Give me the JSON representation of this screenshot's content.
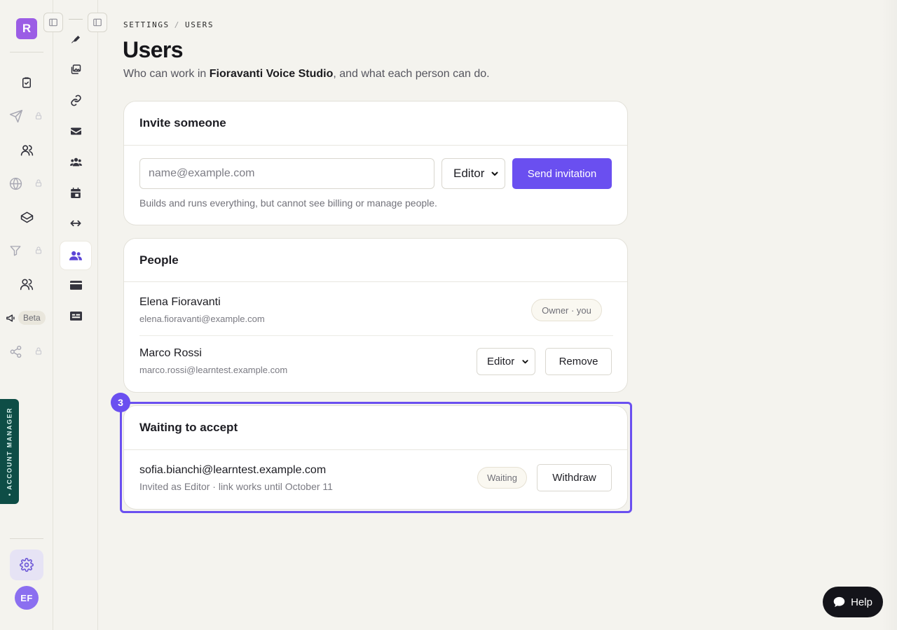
{
  "brand": {
    "letter": "R"
  },
  "primary_nav": [
    {
      "key": "tasks",
      "icon": "clipboard-check-icon",
      "locked": false
    },
    {
      "key": "send",
      "icon": "send-icon",
      "locked": true
    },
    {
      "key": "audience",
      "icon": "users-icon",
      "locked": false
    },
    {
      "key": "web",
      "icon": "globe-icon",
      "locked": true
    },
    {
      "key": "courses",
      "icon": "graduation-cap-icon",
      "locked": false
    },
    {
      "key": "funnels",
      "icon": "funnel-icon",
      "locked": true
    },
    {
      "key": "community",
      "icon": "people-icon",
      "locked": false
    },
    {
      "key": "campaigns",
      "icon": "megaphone-icon",
      "locked": false,
      "badge": "Beta"
    },
    {
      "key": "sharing",
      "icon": "share-icon",
      "locked": true
    }
  ],
  "account_manager_tab": {
    "label": "• ACCOUNT MANAGER"
  },
  "user": {
    "initials": "EF"
  },
  "settings_nav": [
    {
      "icon": "pen-nib-icon",
      "active": false
    },
    {
      "icon": "images-icon",
      "active": false
    },
    {
      "icon": "link-icon",
      "active": false
    },
    {
      "icon": "envelope-icon",
      "active": false
    },
    {
      "icon": "team-icon",
      "active": false
    },
    {
      "icon": "calendar-icon",
      "active": false
    },
    {
      "icon": "arrows-horizontal-icon",
      "active": false
    },
    {
      "icon": "users-active-icon",
      "active": true
    },
    {
      "icon": "credit-card-icon",
      "active": false
    },
    {
      "icon": "id-card-icon",
      "active": false
    }
  ],
  "breadcrumb": {
    "section": "SETTINGS",
    "separator": "/",
    "page": "USERS"
  },
  "page": {
    "title": "Users",
    "subtitle_prefix": "Who can work in ",
    "workspace": "Fioravanti Voice Studio",
    "subtitle_suffix": ", and what each person can do."
  },
  "invite": {
    "heading": "Invite someone",
    "email_placeholder": "name@example.com",
    "role_value": "Editor",
    "send_label": "Send invitation",
    "role_hint": "Builds and runs everything, but cannot see billing or manage people."
  },
  "people": {
    "heading": "People",
    "rows": [
      {
        "name": "Elena Fioravanti",
        "email": "elena.fioravanti@example.com",
        "badge": "Owner · you"
      },
      {
        "name": "Marco Rossi",
        "email": "marco.rossi@learntest.example.com",
        "role": "Editor",
        "action": "Remove"
      }
    ]
  },
  "pending": {
    "heading": "Waiting to accept",
    "step_marker": "3",
    "rows": [
      {
        "email": "sofia.bianchi@learntest.example.com",
        "detail": "Invited as Editor · link works until October 11",
        "status": "Waiting",
        "action": "Withdraw"
      }
    ]
  },
  "help": {
    "label": "Help"
  },
  "colors": {
    "accent": "#6a4ff0",
    "brand": "#9b5de5",
    "account_tab": "#0e4d46",
    "background": "#f4f3ee"
  }
}
